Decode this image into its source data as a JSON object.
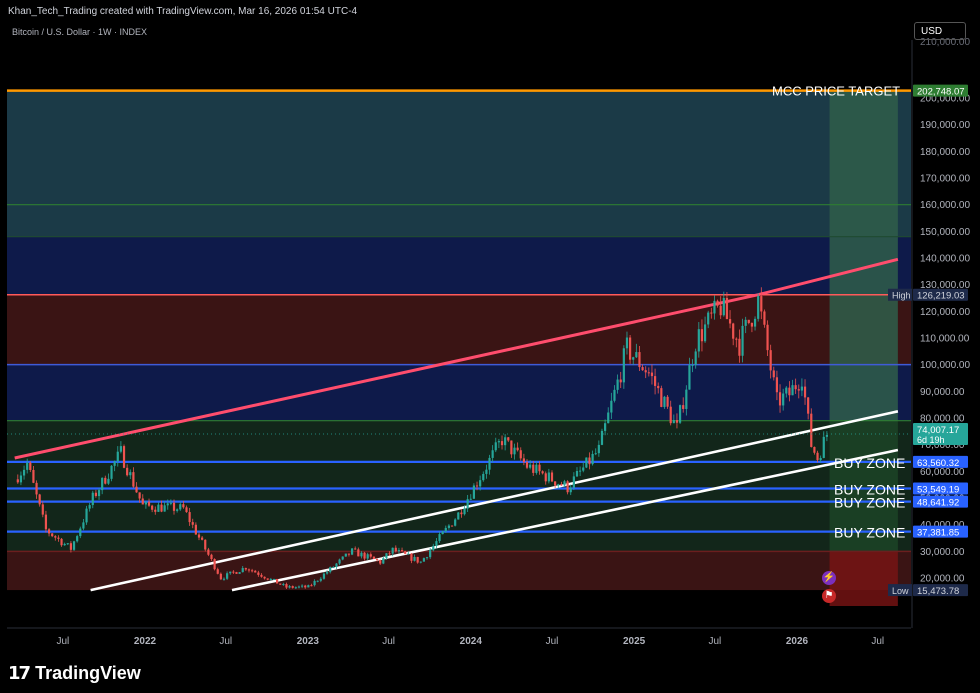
{
  "header": {
    "attribution": "Khan_Tech_Trading created with TradingView.com, Mar 16, 2026 01:54 UTC-4",
    "symbol": "Bitcoin / U.S. Dollar · 1W · INDEX",
    "currency": "USD"
  },
  "footer": {
    "brand": "TradingView"
  },
  "icons": {
    "lightning": "lightning-icon",
    "flag": "us-flag-icon"
  },
  "colors": {
    "background": "#000000",
    "top_zone": "#1b3a47",
    "green_target_box": "#2f5e4a",
    "blue_zone": "#0e1a4a",
    "red_zone": "#3a1414",
    "green_zone": "#12261a",
    "buy_zone_line": "#2962ff",
    "resistance_line": "#ff4d6d",
    "support_line": "#ffffff",
    "target_line": "#ff9800",
    "candle_up": "#26a69a",
    "candle_down": "#ef5350"
  },
  "chart_data": {
    "type": "candlestick",
    "title": "Bitcoin / U.S. Dollar · 1W · INDEX",
    "y_axis_ticks": [
      20000,
      30000,
      40000,
      50000,
      60000,
      70000,
      80000,
      90000,
      100000,
      110000,
      120000,
      130000,
      140000,
      150000,
      160000,
      170000,
      180000,
      190000,
      200000
    ],
    "y_axis_tick_labels": [
      "20,000.00",
      "30,000.00",
      "40,000.00",
      "50,000.00",
      "60,000.00",
      "70,000.00",
      "80,000.00",
      "90,000.00",
      "100,000.00",
      "110,000.00",
      "120,000.00",
      "130,000.00",
      "140,000.00",
      "150,000.00",
      "160,000.00",
      "170,000.00",
      "180,000.00",
      "190,000.00",
      "200,000.00"
    ],
    "x_axis_ticks": [
      {
        "date": "2021-07-01",
        "label": "Jul"
      },
      {
        "date": "2022-01-01",
        "label": "2022"
      },
      {
        "date": "2022-07-01",
        "label": "Jul"
      },
      {
        "date": "2023-01-01",
        "label": "2023"
      },
      {
        "date": "2023-07-01",
        "label": "Jul"
      },
      {
        "date": "2024-01-01",
        "label": "2024"
      },
      {
        "date": "2024-07-01",
        "label": "Jul"
      },
      {
        "date": "2025-01-01",
        "label": "2025"
      },
      {
        "date": "2025-07-01",
        "label": "Jul"
      },
      {
        "date": "2026-01-01",
        "label": "2026"
      },
      {
        "date": "2026-07-01",
        "label": "Jul"
      }
    ],
    "price_labels": [
      {
        "value": 202748.07,
        "text": "202,748.07",
        "kind": "target"
      },
      {
        "value": 126219.03,
        "text": "126,219.03",
        "kind": "high",
        "tag": "High"
      },
      {
        "value": 74007.17,
        "text": "74,007.17",
        "kind": "current",
        "sub": "6d 19h"
      },
      {
        "value": 63560.32,
        "text": "63,560.32",
        "kind": "buy"
      },
      {
        "value": 53549.19,
        "text": "53,549.19",
        "kind": "buy"
      },
      {
        "value": 48641.92,
        "text": "48,641.92",
        "kind": "buy"
      },
      {
        "value": 37381.85,
        "text": "37,381.85",
        "kind": "buy"
      },
      {
        "value": 15473.78,
        "text": "15,473.78",
        "kind": "low",
        "tag": "Low"
      }
    ],
    "horizontal_lines": [
      {
        "value": 202748.07,
        "label": "MCC PRICE TARGET"
      },
      {
        "value": 160000
      },
      {
        "value": 148000
      },
      {
        "value": 126219.03
      },
      {
        "value": 100000
      },
      {
        "value": 79000
      },
      {
        "value": 63560.32,
        "label": "BUY ZONE"
      },
      {
        "value": 53549.19,
        "label": "BUY ZONE"
      },
      {
        "value": 48641.92,
        "label": "BUY ZONE"
      },
      {
        "value": 37381.85,
        "label": "BUY ZONE"
      },
      {
        "value": 30000
      }
    ],
    "zones": [
      {
        "from": 148000,
        "to": 202748.07,
        "name": "top"
      },
      {
        "from": 126219.03,
        "to": 148000,
        "name": "blue"
      },
      {
        "from": 100000,
        "to": 126219.03,
        "name": "red"
      },
      {
        "from": 79000,
        "to": 100000,
        "name": "blue"
      },
      {
        "from": 30000,
        "to": 79000,
        "name": "green"
      },
      {
        "from": 15473.78,
        "to": 30000,
        "name": "red"
      }
    ],
    "target_box": {
      "from_date": "2026-03-15",
      "to_date": "2026-08-15",
      "from": 30000,
      "to": 202748.07
    },
    "trend_lines": [
      {
        "name": "resistance",
        "points": [
          {
            "date": "2021-03-15",
            "value": 65000
          },
          {
            "date": "2025-10-06",
            "value": 126219.03
          },
          {
            "date": "2026-08-15",
            "value": 139500
          }
        ]
      },
      {
        "name": "upper-support",
        "points": [
          {
            "date": "2021-09-01",
            "value": 15473.78
          },
          {
            "date": "2026-08-15",
            "value": 82500
          }
        ]
      },
      {
        "name": "lower-support",
        "points": [
          {
            "date": "2022-07-15",
            "value": 15473.78
          },
          {
            "date": "2026-08-15",
            "value": 68000
          }
        ]
      }
    ],
    "price_path": [
      {
        "date": "2021-03-15",
        "value": 57000
      },
      {
        "date": "2021-04-12",
        "value": 63000
      },
      {
        "date": "2021-05-24",
        "value": 38000
      },
      {
        "date": "2021-07-19",
        "value": 31000
      },
      {
        "date": "2021-09-06",
        "value": 50000
      },
      {
        "date": "2021-11-08",
        "value": 67000
      },
      {
        "date": "2021-12-27",
        "value": 47000
      },
      {
        "date": "2022-03-28",
        "value": 46000
      },
      {
        "date": "2022-06-20",
        "value": 20000
      },
      {
        "date": "2022-08-15",
        "value": 24000
      },
      {
        "date": "2022-11-14",
        "value": 16500
      },
      {
        "date": "2023-01-02",
        "value": 16600
      },
      {
        "date": "2023-04-10",
        "value": 30000
      },
      {
        "date": "2023-06-12",
        "value": 26000
      },
      {
        "date": "2023-07-10",
        "value": 30500
      },
      {
        "date": "2023-09-11",
        "value": 26000
      },
      {
        "date": "2023-12-04",
        "value": 44000
      },
      {
        "date": "2024-03-11",
        "value": 72000
      },
      {
        "date": "2024-05-06",
        "value": 62000
      },
      {
        "date": "2024-07-01",
        "value": 57000
      },
      {
        "date": "2024-08-05",
        "value": 54000
      },
      {
        "date": "2024-10-14",
        "value": 68000
      },
      {
        "date": "2024-12-16",
        "value": 106000
      },
      {
        "date": "2025-02-03",
        "value": 97000
      },
      {
        "date": "2025-04-07",
        "value": 76000
      },
      {
        "date": "2025-05-19",
        "value": 109000
      },
      {
        "date": "2025-07-14",
        "value": 122000
      },
      {
        "date": "2025-08-25",
        "value": 108000
      },
      {
        "date": "2025-10-06",
        "value": 124000
      },
      {
        "date": "2025-11-17",
        "value": 86000
      },
      {
        "date": "2025-12-15",
        "value": 89000
      },
      {
        "date": "2026-01-12",
        "value": 96000
      },
      {
        "date": "2026-02-02",
        "value": 70000
      },
      {
        "date": "2026-02-16",
        "value": 65000
      },
      {
        "date": "2026-03-09",
        "value": 74007.17
      }
    ]
  }
}
